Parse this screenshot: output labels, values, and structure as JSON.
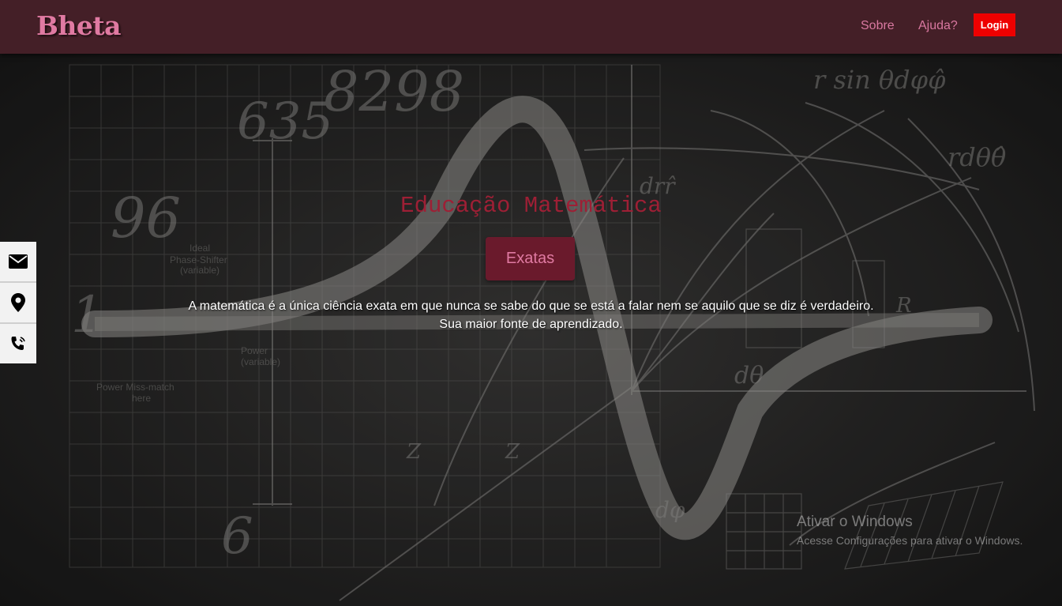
{
  "nav": {
    "brand": "Bheta",
    "links": [
      "Sobre",
      "Ajuda?"
    ],
    "login": "Login"
  },
  "hero": {
    "title": "Educação Matemática",
    "button": "Exatas",
    "line1": "A matemática é a única ciência exata em que nunca se sabe do que se está a falar nem se aquilo que se diz é verdadeiro.",
    "line2": "Sua maior fonte de aprendizado."
  },
  "sidebar": {
    "icons": [
      "envelope-icon",
      "map-marker-icon",
      "phone-volume-icon"
    ]
  },
  "watermark": {
    "title": "Ativar o Windows",
    "subtitle": "Acesse Configurações para ativar o Windows."
  },
  "colors": {
    "navbar": "#441f27",
    "brand": "#e07aa2",
    "title": "#9e1f35",
    "hero_button": "#6a1a2c",
    "login": "#ee0000"
  }
}
